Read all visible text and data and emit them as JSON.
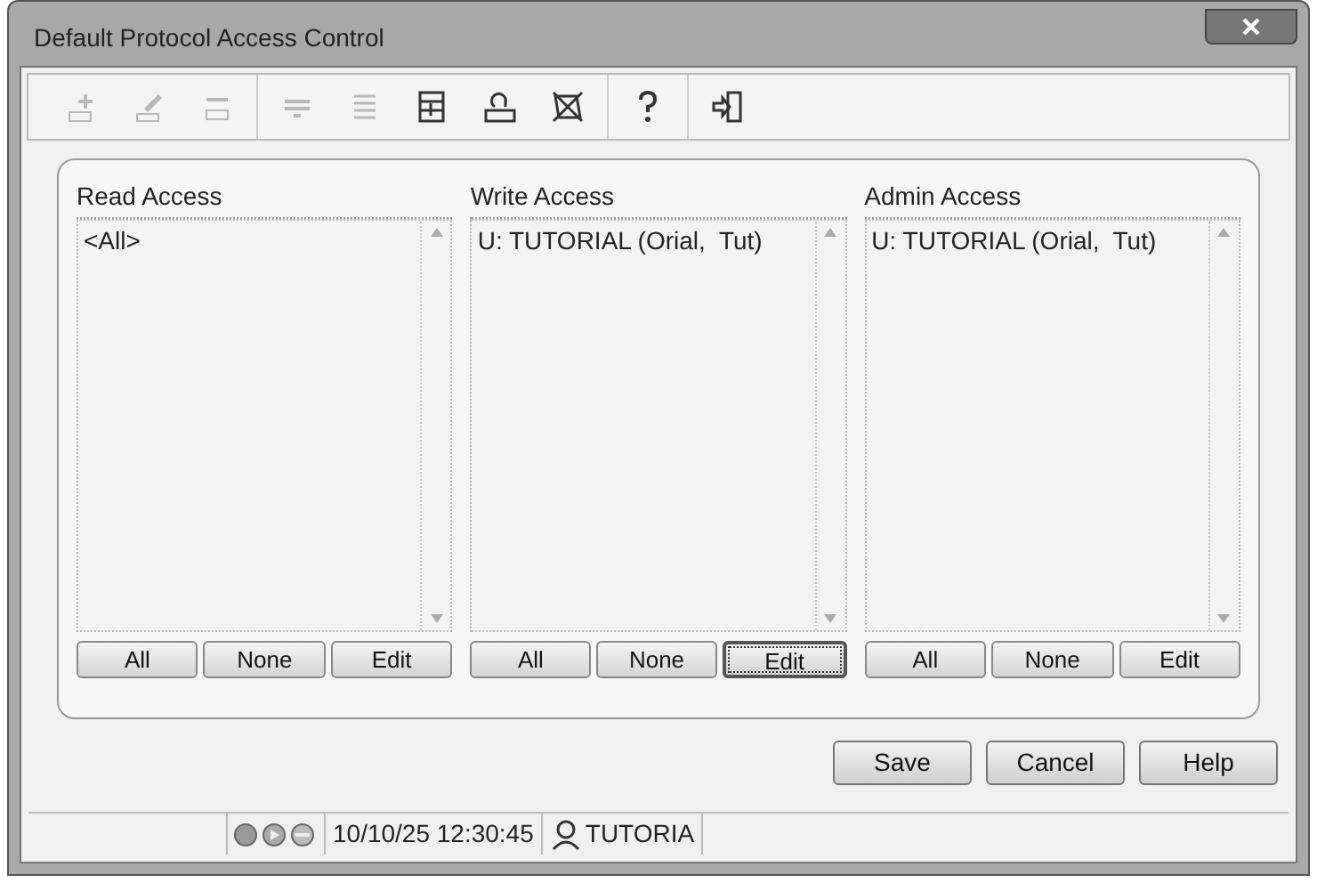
{
  "window": {
    "title": "Default Protocol Access Control"
  },
  "toolbar": {
    "groups": [
      [
        {
          "disabled": true
        },
        {
          "disabled": true
        },
        {
          "disabled": true
        }
      ],
      [
        {
          "disabled": true
        },
        {
          "disabled": true
        },
        {
          "disabled": false
        },
        {
          "disabled": false
        },
        {
          "disabled": false
        }
      ],
      [
        {
          "disabled": false
        }
      ],
      [
        {
          "disabled": false
        }
      ]
    ]
  },
  "panes": [
    {
      "title": "Read Access",
      "items": [
        "<All>"
      ],
      "buttons": [
        {
          "label": "All",
          "focused": false
        },
        {
          "label": "None",
          "focused": false
        },
        {
          "label": "Edit",
          "focused": false
        }
      ]
    },
    {
      "title": "Write Access",
      "items": [
        "U: TUTORIAL (Orial,  Tut)"
      ],
      "buttons": [
        {
          "label": "All",
          "focused": false
        },
        {
          "label": "None",
          "focused": false
        },
        {
          "label": "Edit",
          "focused": true
        }
      ]
    },
    {
      "title": "Admin Access",
      "items": [
        "U: TUTORIAL (Orial,  Tut)"
      ],
      "buttons": [
        {
          "label": "All",
          "focused": false
        },
        {
          "label": "None",
          "focused": false
        },
        {
          "label": "Edit",
          "focused": false
        }
      ]
    }
  ],
  "dialog_buttons": [
    "Save",
    "Cancel",
    "Help"
  ],
  "status_bar": {
    "datetime": "10/10/25 12:30:45",
    "user": "TUTORIA"
  }
}
